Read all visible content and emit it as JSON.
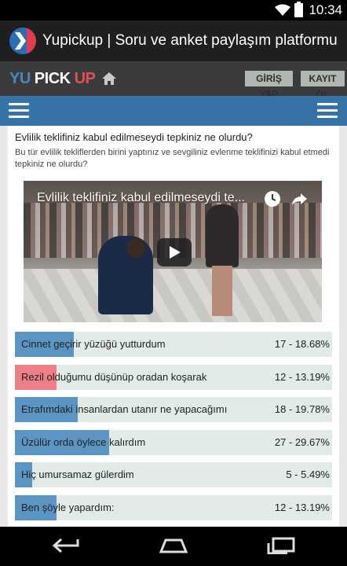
{
  "status_bar": {
    "time": "10:34"
  },
  "app_bar": {
    "title": "Yupickup | Soru ve anket paylaşım platformu"
  },
  "site_header": {
    "brand": {
      "yu": "YU",
      "pick": "PICK",
      "up": "UP"
    },
    "login_label": "GİRİŞ YAP",
    "register_label": "KAYIT OL"
  },
  "question": {
    "title": "Evlilik teklifiniz kabul edilmeseydi tepkiniz ne olurdu?",
    "description": "Bu tür evlilik tekliflerden birini yaptınız ve sevgiliniz evlenme teklifinizi kabul etmedi tepkiniz ne olurdu?"
  },
  "video": {
    "title": "Evlilik teklifiniz kabul edilmeseydi te...",
    "icons": [
      "clock-icon",
      "share-icon",
      "play-icon"
    ]
  },
  "answers": [
    {
      "label": "Cinnet geçirir yüzüğü yutturdum",
      "stats": "17 - 18.68%",
      "percent": 18.68,
      "color": "#5b95c4"
    },
    {
      "label": "Rezil olduğumu düşünüp oradan koşarak",
      "stats": "12 - 13.19%",
      "percent": 13.19,
      "color": "#ec7f88"
    },
    {
      "label": "Etrafımdaki insanlardan utanır ne yapacağımı",
      "stats": "18 - 19.78%",
      "percent": 19.78,
      "color": "#5b95c4"
    },
    {
      "label": "Üzülür orda öylece kalırdım",
      "stats": "27 - 29.67%",
      "percent": 29.67,
      "color": "#5b95c4"
    },
    {
      "label": "Hiç umursamaz gülerdim",
      "stats": "5 - 5.49%",
      "percent": 5.49,
      "color": "#5b95c4"
    },
    {
      "label": "Ben şöyle yapardım:",
      "stats": "12 - 13.19%",
      "percent": 13.19,
      "color": "#5b95c4"
    }
  ],
  "nav_icons": [
    "back-icon",
    "home-icon",
    "recent-apps-icon"
  ]
}
